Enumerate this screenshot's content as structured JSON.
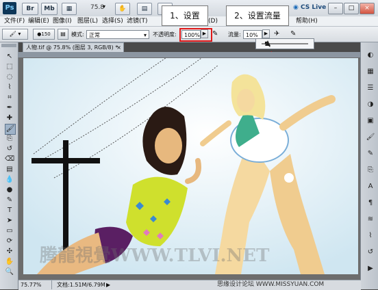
{
  "appbar": {
    "logo": "Ps",
    "buttons": [
      "Br",
      "Mb"
    ],
    "zoom": "75.8",
    "cslive": "CS Live"
  },
  "menus": [
    "文件(F)",
    "编辑(E)",
    "图像(I)",
    "图层(L)",
    "选择(S)",
    "滤镜(T)",
    "(D)",
    "帮助(H)"
  ],
  "options": {
    "brush_size": "150",
    "mode_label": "模式:",
    "mode_value": "正常",
    "opacity_label": "不透明度:",
    "opacity_value": "100%",
    "flow_label": "流量:",
    "flow_value": "10%"
  },
  "callouts": {
    "step1": "1、设置",
    "step2": "2、设置流量"
  },
  "document": {
    "tab_title": "人物.tif @ 75.8% (图层 3, RGB/8) *",
    "close": "×"
  },
  "status": {
    "zoom": "75.77%",
    "doc_info": "文档:1.51M/6.79M"
  },
  "watermarks": {
    "main": "腾龍視覺WWW.TLVI.NET",
    "bottom": "思缘设计论坛 WWW.MISSYUAN.COM"
  },
  "icons": {
    "tools": [
      "move-icon",
      "marquee-icon",
      "lasso-icon",
      "quick-select-icon",
      "crop-icon",
      "eyedropper-icon",
      "healing-icon",
      "brush-icon",
      "clone-stamp-icon",
      "history-brush-icon",
      "eraser-icon",
      "gradient-icon",
      "blur-icon",
      "dodge-icon",
      "pen-icon",
      "type-icon",
      "path-select-icon",
      "shape-icon",
      "3d-rotate-icon",
      "3d-orbit-icon",
      "hand-icon",
      "zoom-icon"
    ],
    "panel": [
      "color-icon",
      "swatches-icon",
      "layers-icon",
      "adjustments-icon",
      "masks-icon",
      "brush-panel-icon",
      "tool-presets-icon",
      "clone-source-icon",
      "character-icon",
      "paragraph-icon",
      "channels-icon",
      "paths-icon",
      "history-icon",
      "actions-icon"
    ]
  },
  "colors": {
    "highlight": "#e01818",
    "canvas_bg": "#d9ecf4"
  }
}
